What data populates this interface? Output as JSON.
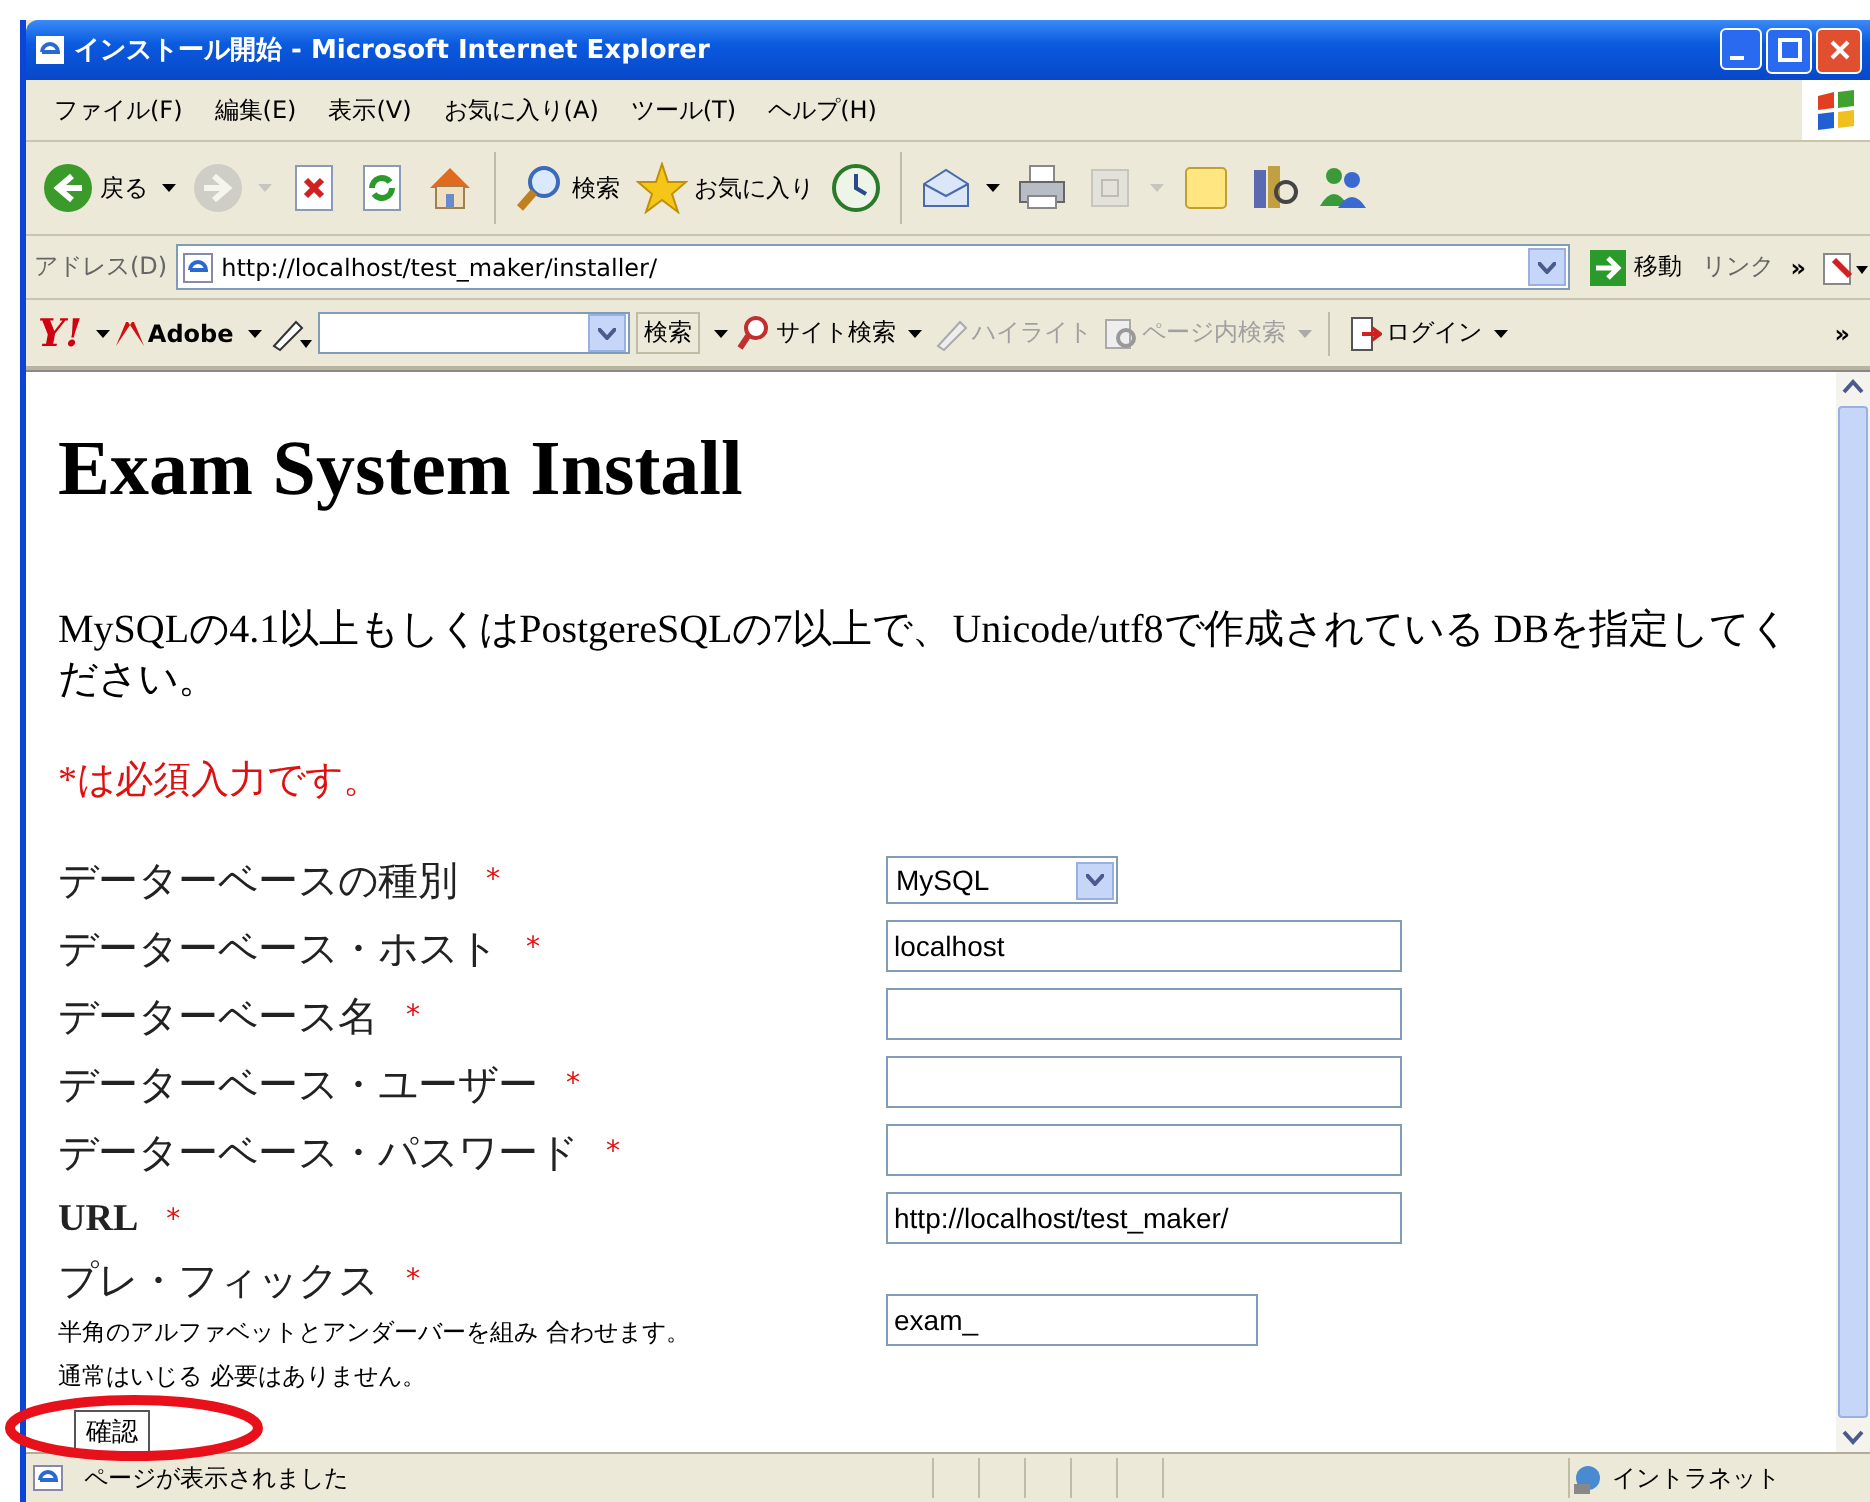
{
  "window": {
    "title": "インストール開始 - Microsoft Internet Explorer"
  },
  "menu": [
    "ファイル(F)",
    "編集(E)",
    "表示(V)",
    "お気に入り(A)",
    "ツール(T)",
    "ヘルプ(H)"
  ],
  "toolbar": [
    {
      "kind": "back",
      "label": "戻る",
      "dropdown": true,
      "disabled": false
    },
    {
      "kind": "forward",
      "dropdown": true,
      "disabled": true
    },
    {
      "kind": "stop",
      "dropdown": false,
      "disabled": false
    },
    {
      "kind": "refresh",
      "dropdown": false,
      "disabled": false
    },
    {
      "kind": "home",
      "dropdown": false,
      "disabled": false
    },
    {
      "kind": "search",
      "label": "検索",
      "dropdown": false,
      "disabled": false
    },
    {
      "kind": "favorites",
      "label": "お気に入り",
      "dropdown": false,
      "disabled": false
    },
    {
      "kind": "history",
      "dropdown": false,
      "disabled": false
    },
    {
      "kind": "mail",
      "dropdown": true,
      "disabled": false
    },
    {
      "kind": "print",
      "dropdown": false,
      "disabled": false
    },
    {
      "kind": "edit",
      "dropdown": true,
      "disabled": true
    },
    {
      "kind": "note",
      "dropdown": false,
      "disabled": false
    },
    {
      "kind": "research",
      "dropdown": false,
      "disabled": false
    },
    {
      "kind": "messenger",
      "dropdown": false,
      "disabled": false
    }
  ],
  "address": {
    "label": "アドレス(D)",
    "value": "http://localhost/test_maker/installer/",
    "go": "移動",
    "links": "リンク",
    "more": "»"
  },
  "search_toolbar": {
    "logo": "Y!",
    "adobe": "Adobe",
    "search_button": "検索",
    "items": [
      {
        "label": "サイト検索",
        "disabled": false,
        "dropdown": true
      },
      {
        "label": "ハイライト",
        "disabled": true,
        "dropdown": false
      },
      {
        "label": "ページ内検索",
        "disabled": true,
        "dropdown": true
      },
      {
        "label": "ログイン",
        "disabled": false,
        "dropdown": true
      }
    ],
    "more": "»"
  },
  "page": {
    "heading": "Exam System Install",
    "intro": "MySQLの4.1以上もしくはPostgereSQLの7以上で、Unicode/utf8で作成されている DBを指定してください。",
    "required_note": "*は必須入力です。",
    "fields": [
      {
        "label": "データーベースの種別",
        "required": "*",
        "kind": "select",
        "value": "MySQL"
      },
      {
        "label": "データーベース・ホスト",
        "required": "*",
        "kind": "text",
        "value": "localhost"
      },
      {
        "label": "データーベース名",
        "required": "*",
        "kind": "text"
      },
      {
        "label": "データーベース・ユーザー",
        "required": "*",
        "kind": "text"
      },
      {
        "label": "データーベース・パスワード",
        "required": "*",
        "kind": "text"
      },
      {
        "label": "URL",
        "required": "*",
        "kind": "text",
        "value": "http://localhost/test_maker/",
        "serif": true
      },
      {
        "label": "プレ・フィックス",
        "required": "*",
        "kind": "short",
        "value": "exam_",
        "notes": [
          "半角のアルファベットとアンダーバーを組み 合わせます。",
          "通常はいじる 必要はありません。"
        ]
      }
    ],
    "submit": "確認"
  },
  "status_bar": {
    "text": "ページが表示されました",
    "zone": "イントラネット"
  }
}
